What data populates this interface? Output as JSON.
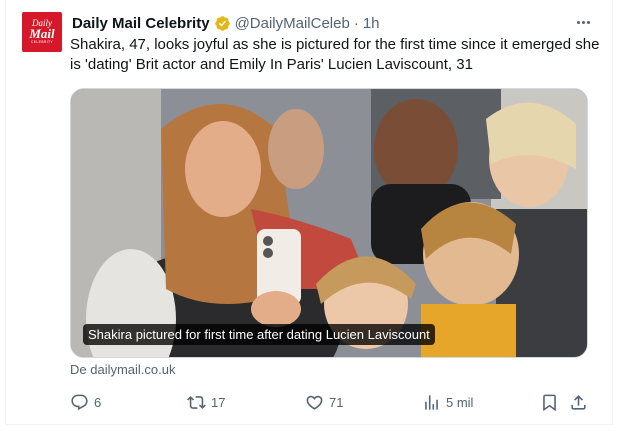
{
  "account": {
    "avatar_line1": "Daily",
    "avatar_line2": "Mail",
    "avatar_line3": "CELEBRITY",
    "name": "Daily Mail Celebrity",
    "handle": "@DailyMailCeleb",
    "separator": "·",
    "time": "1h",
    "brand_color": "#d6182b",
    "verified_color": "#e2b719"
  },
  "tweet": {
    "text": "Shakira, 47, looks joyful as she is pictured for the first time since it emerged she is 'dating' Brit actor and Emily In Paris' Lucien Laviscount, 31"
  },
  "media": {
    "caption": "Shakira pictured for first time after dating Lucien Laviscount"
  },
  "source": {
    "text": "De dailymail.co.uk"
  },
  "actions": {
    "replies": "6",
    "reposts": "17",
    "likes": "71",
    "views": "5 mil"
  },
  "icons": {
    "more": "more-dots-icon",
    "verified": "verified-badge-icon",
    "reply": "reply-icon",
    "repost": "repost-icon",
    "like": "heart-icon",
    "views": "views-chart-icon",
    "bookmark": "bookmark-icon",
    "share": "share-icon"
  }
}
